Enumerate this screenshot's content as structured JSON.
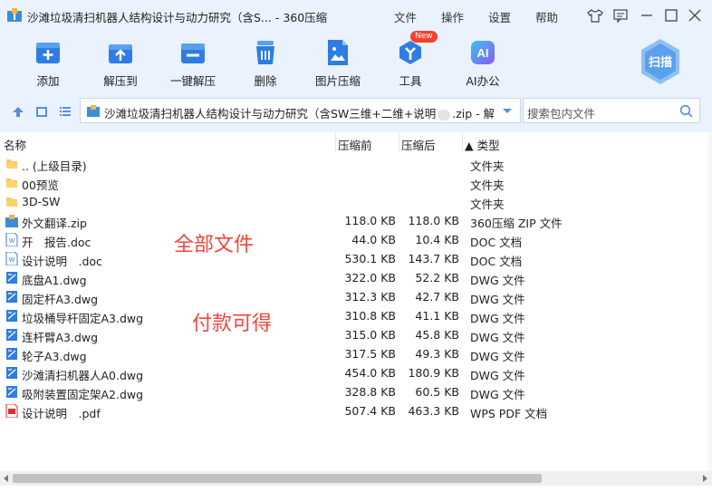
{
  "window": {
    "title": "沙滩垃圾清扫机器人结构设计与动力研究（含S... - 360压缩",
    "menu": [
      "文件",
      "操作",
      "设置",
      "帮助"
    ]
  },
  "toolbar": {
    "buttons": [
      {
        "label": "添加",
        "icon": "add-icon"
      },
      {
        "label": "解压到",
        "icon": "extract-to-icon"
      },
      {
        "label": "一键解压",
        "icon": "one-click-extract-icon"
      },
      {
        "label": "删除",
        "icon": "trash-icon"
      },
      {
        "label": "图片压缩",
        "icon": "image-compress-icon"
      },
      {
        "label": "工具",
        "icon": "tools-icon",
        "badge": "New"
      },
      {
        "label": "AI办公",
        "icon": "ai-office-icon",
        "glyph": "AI"
      }
    ],
    "scan_label": "扫描"
  },
  "address": {
    "path": "沙滩垃圾清扫机器人结构设计与动力研究（含SW三维+二维+说明",
    "path_suffix": ".zip - 解",
    "search_placeholder": "搜索包内文件"
  },
  "columns": {
    "name": "名称",
    "compressed": "压缩前",
    "after": "压缩后",
    "type": "▲ 类型"
  },
  "files": [
    {
      "name": ".. (上级目录)",
      "before": "",
      "after": "",
      "type": "文件夹",
      "icon": "folder-icon"
    },
    {
      "name": "00预览",
      "before": "",
      "after": "",
      "type": "文件夹",
      "icon": "folder-icon"
    },
    {
      "name": "3D-SW",
      "before": "",
      "after": "",
      "type": "文件夹",
      "icon": "folder-icon"
    },
    {
      "name": "外文翻译.zip",
      "before": "118.0 KB",
      "after": "118.0 KB",
      "type": "360压缩 ZIP 文件",
      "icon": "zip-icon"
    },
    {
      "name": "开　报告.doc",
      "before": "44.0 KB",
      "after": "10.4 KB",
      "type": "DOC 文档",
      "icon": "doc-icon"
    },
    {
      "name": "设计说明　.doc",
      "before": "530.1 KB",
      "after": "143.7 KB",
      "type": "DOC 文档",
      "icon": "doc-icon"
    },
    {
      "name": "底盘A1.dwg",
      "before": "322.0 KB",
      "after": "52.2 KB",
      "type": "DWG 文件",
      "icon": "dwg-icon"
    },
    {
      "name": "固定杆A3.dwg",
      "before": "312.3 KB",
      "after": "42.7 KB",
      "type": "DWG 文件",
      "icon": "dwg-icon"
    },
    {
      "name": "垃圾桶导杆固定A3.dwg",
      "before": "310.8 KB",
      "after": "41.1 KB",
      "type": "DWG 文件",
      "icon": "dwg-icon"
    },
    {
      "name": "连杆臂A3.dwg",
      "before": "315.0 KB",
      "after": "45.8 KB",
      "type": "DWG 文件",
      "icon": "dwg-icon"
    },
    {
      "name": "轮子A3.dwg",
      "before": "317.5 KB",
      "after": "49.3 KB",
      "type": "DWG 文件",
      "icon": "dwg-icon"
    },
    {
      "name": "沙滩清扫机器人A0.dwg",
      "before": "454.0 KB",
      "after": "180.9 KB",
      "type": "DWG 文件",
      "icon": "dwg-icon"
    },
    {
      "name": "吸附装置固定架A2.dwg",
      "before": "328.8 KB",
      "after": "60.5 KB",
      "type": "DWG 文件",
      "icon": "dwg-icon"
    },
    {
      "name": "设计说明　.pdf",
      "before": "507.4 KB",
      "after": "463.3 KB",
      "type": "WPS PDF 文档",
      "icon": "pdf-icon"
    }
  ],
  "overlays": [
    "全部文件",
    "付款可得"
  ],
  "colors": {
    "accent": "#2f7de1",
    "toolbar_bg": "#eaf2fd",
    "overlay_red": "#f1453d"
  }
}
